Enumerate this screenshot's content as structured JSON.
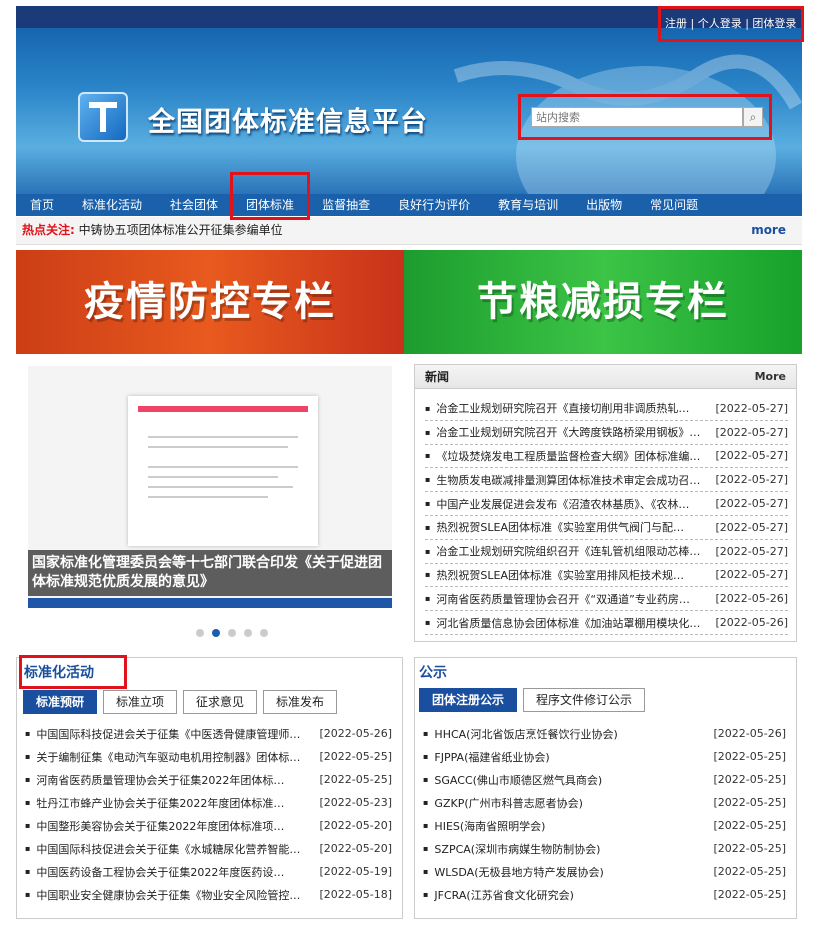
{
  "header": {
    "top_links": [
      "注册",
      "个人登录",
      "团体登录"
    ],
    "site_name": "全国团体标准信息平台",
    "search": {
      "placeholder": "站内搜索",
      "icon": "search-icon"
    }
  },
  "nav": {
    "items": [
      "首页",
      "标准化活动",
      "社会团体",
      "团体标准",
      "监督抽查",
      "良好行为评价",
      "教育与培训",
      "出版物",
      "常见问题"
    ],
    "highlighted": "团体标准"
  },
  "hot": {
    "label": "热点关注:",
    "text": "中铸协五项团体标准公开征集参编单位",
    "more": "more"
  },
  "banners": {
    "left": "疫情防控专栏",
    "right": "节粮减损专栏"
  },
  "slider": {
    "caption": "国家标准化管理委员会等十七部门联合印发《关于促进团体标准规范优质发展的意见》",
    "dots": 5,
    "active": 2
  },
  "news": {
    "title": "新闻",
    "more": "More",
    "items": [
      {
        "t": "冶金工业规划研究院召开《直接切削用非调质热轧…",
        "d": "[2022-05-27]"
      },
      {
        "t": "冶金工业规划研究院召开《大跨度铁路桥梁用钢板》…",
        "d": "[2022-05-27]"
      },
      {
        "t": "《垃圾焚烧发电工程质量监督检查大纲》团体标准编…",
        "d": "[2022-05-27]"
      },
      {
        "t": "生物质发电碳减排量测算团体标准技术审定会成功召…",
        "d": "[2022-05-27]"
      },
      {
        "t": "中国产业发展促进会发布《沼渣农林基质》、《农林…",
        "d": "[2022-05-27]"
      },
      {
        "t": "热烈祝贺SLEA团体标准《实验室用供气阀门与配…",
        "d": "[2022-05-27]"
      },
      {
        "t": "冶金工业规划研究院组织召开《连轧管机组限动芯棒…",
        "d": "[2022-05-27]"
      },
      {
        "t": "热烈祝贺SLEA团体标准《实验室用排风柜技术规…",
        "d": "[2022-05-27]"
      },
      {
        "t": "河南省医药质量管理协会召开《“双通道”专业药房…",
        "d": "[2022-05-26]"
      },
      {
        "t": "河北省质量信息协会团体标准《加油站罩棚用模块化…",
        "d": "[2022-05-26]"
      }
    ]
  },
  "activities": {
    "title": "标准化活动",
    "tabs": [
      "标准预研",
      "标准立项",
      "征求意见",
      "标准发布"
    ],
    "active_tab": "标准预研",
    "items": [
      {
        "t": "中国国际科技促进会关于征集《中医透骨健康管理师…",
        "d": "[2022-05-26]"
      },
      {
        "t": "关于编制征集《电动汽车驱动电机用控制器》团体标…",
        "d": "[2022-05-25]"
      },
      {
        "t": "河南省医药质量管理协会关于征集2022年团体标…",
        "d": "[2022-05-25]"
      },
      {
        "t": "牡丹江市蜂产业协会关于征集2022年度团体标准…",
        "d": "[2022-05-23]"
      },
      {
        "t": "中国整形美容协会关于征集2022年度团体标准项…",
        "d": "[2022-05-20]"
      },
      {
        "t": "中国国际科技促进会关于征集《水城糖尿化营养智能…",
        "d": "[2022-05-20]"
      },
      {
        "t": "中国医药设备工程协会关于征集2022年度医药设…",
        "d": "[2022-05-19]"
      },
      {
        "t": "中国职业安全健康协会关于征集《物业安全风险管控…",
        "d": "[2022-05-18]"
      }
    ]
  },
  "gonggao": {
    "title": "公示",
    "tabs": [
      "团体注册公示",
      "程序文件修订公示"
    ],
    "active_tab": "团体注册公示",
    "items": [
      {
        "t": "HHCA(河北省饭店烹饪餐饮行业协会)",
        "d": "[2022-05-26]"
      },
      {
        "t": "FJPPA(福建省纸业协会)",
        "d": "[2022-05-25]"
      },
      {
        "t": "SGACC(佛山市顺德区燃气具商会)",
        "d": "[2022-05-25]"
      },
      {
        "t": "GZKP(广州市科普志愿者协会)",
        "d": "[2022-05-25]"
      },
      {
        "t": "HIES(海南省照明学会)",
        "d": "[2022-05-25]"
      },
      {
        "t": "SZPCA(深圳市病媒生物防制协会)",
        "d": "[2022-05-25]"
      },
      {
        "t": "WLSDA(无极县地方特产发展协会)",
        "d": "[2022-05-25]"
      },
      {
        "t": "JFCRA(江苏省食文化研究会)",
        "d": "[2022-05-25]"
      }
    ]
  },
  "colors": {
    "accent": "#1a4fa0",
    "highlight": "#e0131b",
    "nav": "#1a60aa"
  }
}
